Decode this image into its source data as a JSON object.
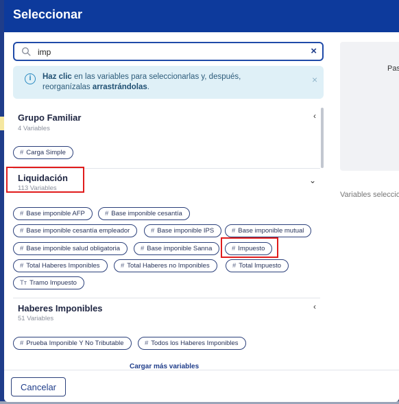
{
  "dialog": {
    "title": "Seleccionar"
  },
  "search": {
    "value": "imp",
    "clear_icon": "×"
  },
  "info": {
    "bold_1": "Haz clic",
    "text_1": " en las variables para seleccionarlas y, después, reorganízalas ",
    "bold_2": "arrastrándolas",
    "text_2": ".",
    "close_icon": "×"
  },
  "groups": [
    {
      "title": "Grupo Familiar",
      "count": "4 Variables",
      "chevron": "‹",
      "chips": [
        {
          "icon": "#",
          "label": "Carga Simple"
        }
      ]
    },
    {
      "title": "Liquidación",
      "count": "113 Variables",
      "chevron": "⌄",
      "chips": [
        {
          "icon": "#",
          "label": "Base imponible AFP"
        },
        {
          "icon": "#",
          "label": "Base imponible cesantía"
        },
        {
          "icon": "#",
          "label": "Base imponible cesantía empleador"
        },
        {
          "icon": "#",
          "label": "Base imponible IPS"
        },
        {
          "icon": "#",
          "label": "Base imponible mutual"
        },
        {
          "icon": "#",
          "label": "Base imponible salud obligatoria"
        },
        {
          "icon": "#",
          "label": "Base imponible Sanna"
        },
        {
          "icon": "#",
          "label": "Impuesto"
        },
        {
          "icon": "#",
          "label": "Total Haberes Imponibles"
        },
        {
          "icon": "#",
          "label": "Total Haberes no Imponibles"
        },
        {
          "icon": "#",
          "label": "Total Impuesto"
        },
        {
          "icon": "Tт",
          "label": "Tramo Impuesto"
        }
      ]
    },
    {
      "title": "Haberes Imponibles",
      "count": "51 Variables",
      "chevron": "‹",
      "chips": [
        {
          "icon": "#",
          "label": "Prueba Imponible Y No Tributable"
        },
        {
          "icon": "#",
          "label": "Todos los Haberes Imponibles"
        }
      ]
    }
  ],
  "load_more": "Cargar más variables",
  "right_panel": {
    "label": "Pas",
    "caption": "Variables selecciona"
  },
  "footer": {
    "cancel_label": "Cancelar"
  },
  "colors": {
    "header": "#0d3a9c",
    "accent": "#1f3d8a",
    "info_bg": "#dff0f7",
    "highlight": "#e01b1b"
  }
}
